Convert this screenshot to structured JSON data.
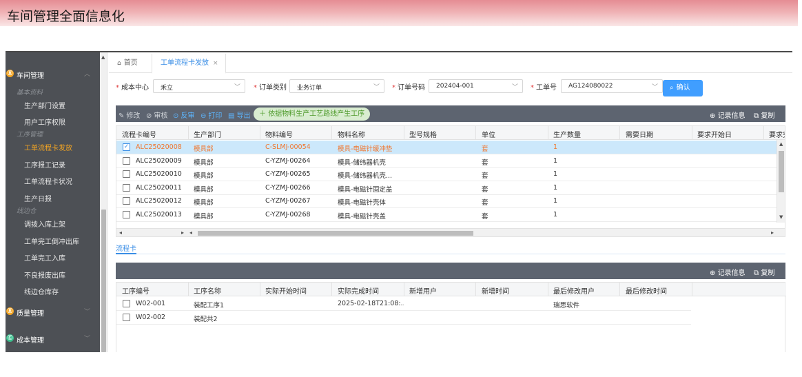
{
  "banner": {
    "title": "车间管理全面信息化"
  },
  "sidebar": {
    "groups": [
      {
        "label": "车间管理",
        "icon": "workshop-icon",
        "color": "#f5a623",
        "expanded": true
      },
      {
        "label": "质量管理",
        "icon": "quality-icon",
        "color": "#f5a623",
        "expanded": false
      },
      {
        "label": "成本管理",
        "icon": "cost-icon",
        "color": "#3cbf8e",
        "expanded": false
      }
    ],
    "sections": [
      {
        "label": "基本资料",
        "items": [
          "生产部门设置",
          "用户工序权限"
        ]
      },
      {
        "label": "工序管理",
        "items": [
          "工单流程卡发放",
          "工序报工记录",
          "工单流程卡状况",
          "生产日报"
        ]
      },
      {
        "label": "线边仓",
        "items": [
          "调拨入库上架",
          "工单完工倒冲出库",
          "工单完工入库",
          "不良报废出库",
          "线边仓库存"
        ]
      }
    ],
    "active_item": "工单流程卡发放"
  },
  "tabs": {
    "home": "首页",
    "active": "工单流程卡发放",
    "close_glyph": "×"
  },
  "filters": {
    "cost_center": {
      "label": "成本中心",
      "value": "禾立"
    },
    "order_type": {
      "label": "订单类别",
      "value": "业务订单"
    },
    "order_no": {
      "label": "订单号码",
      "value": "202404-001"
    },
    "work_order": {
      "label": "工单号",
      "value": "AG124080022"
    },
    "confirm_label": "确认"
  },
  "toolbar": {
    "edit": "修改",
    "audit": "审核",
    "unaudit": "反审",
    "print": "打印",
    "export": "导出",
    "generate": "依据物料生产工艺路线产生工序",
    "record_info": "记录信息",
    "copy": "复制"
  },
  "grid": {
    "columns": [
      "流程卡编号",
      "生产部门",
      "物料编号",
      "物料名称",
      "型号规格",
      "单位",
      "生产数量",
      "需要日期",
      "要求开始日",
      "要求完"
    ],
    "rows": [
      {
        "card_no": "ALC25020008",
        "dept": "模具部",
        "material_no": "C-SLMJ-00054",
        "material_name": "模具-电磁针缓冲垫",
        "spec": "",
        "unit": "套",
        "qty": "1",
        "checked": true
      },
      {
        "card_no": "ALC25020009",
        "dept": "模具部",
        "material_no": "C-YZMJ-00264",
        "material_name": "模具-储纬器机壳",
        "spec": "",
        "unit": "套",
        "qty": "1",
        "checked": false
      },
      {
        "card_no": "ALC25020010",
        "dept": "模具部",
        "material_no": "C-YZMJ-00265",
        "material_name": "模具-储纬器机壳...",
        "spec": "",
        "unit": "套",
        "qty": "1",
        "checked": false
      },
      {
        "card_no": "ALC25020011",
        "dept": "模具部",
        "material_no": "C-YZMJ-00266",
        "material_name": "模具-电磁针固定盖",
        "spec": "",
        "unit": "套",
        "qty": "1",
        "checked": false
      },
      {
        "card_no": "ALC25020012",
        "dept": "模具部",
        "material_no": "C-YZMJ-00267",
        "material_name": "模具-电磁针壳体",
        "spec": "",
        "unit": "套",
        "qty": "1",
        "checked": false
      },
      {
        "card_no": "ALC25020013",
        "dept": "模具部",
        "material_no": "C-YZMJ-00268",
        "material_name": "模具-电磁针壳盖",
        "spec": "",
        "unit": "套",
        "qty": "1",
        "checked": false
      }
    ]
  },
  "subtab": {
    "label": "流程卡"
  },
  "toolbar2": {
    "record_info": "记录信息",
    "copy": "复制"
  },
  "grid2": {
    "columns": [
      "工序编号",
      "工序名称",
      "实际开始时间",
      "实际完成时间",
      "新增用户",
      "新增时间",
      "最后修改用户",
      "最后修改时间"
    ],
    "rows": [
      {
        "op_no": "W02-001",
        "op_name": "装配工序1",
        "start": "",
        "finish": "2025-02-18T21:08:...",
        "creator": "",
        "created": "",
        "modifier": "瑞思软件",
        "modified": ""
      },
      {
        "op_no": "W02-002",
        "op_name": "装配共2",
        "start": "",
        "finish": "",
        "creator": "",
        "created": "",
        "modifier": "",
        "modified": ""
      }
    ]
  },
  "colors": {
    "accent": "#409eff",
    "selected_row": "#cce8fb",
    "selected_text": "#f0762f",
    "toolbar_bg": "#5d6470",
    "sidebar_bg": "#4d5055"
  }
}
